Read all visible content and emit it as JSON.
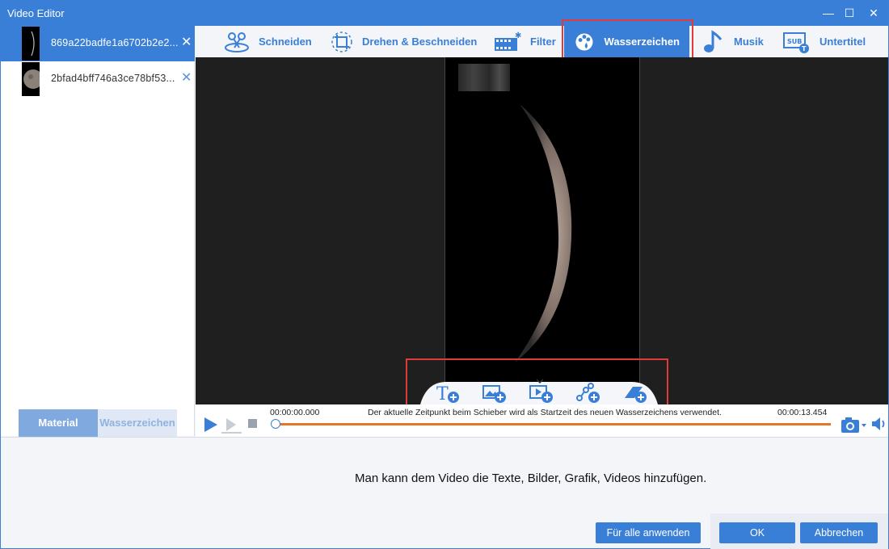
{
  "window": {
    "title": "Video Editor",
    "minimize": "—",
    "maximize": "☐",
    "close": "✕"
  },
  "files": [
    {
      "name": "869a22badfe1a6702b2e2...",
      "remove": "✕",
      "selected": true
    },
    {
      "name": "2bfad4bff746a3ce78bf53...",
      "remove": "✕",
      "selected": false
    }
  ],
  "left_tabs": {
    "material": "Material",
    "watermark": "Wasserzeichen"
  },
  "toolbar": {
    "cut": "Schneiden",
    "rotate_crop": "Drehen & Beschneiden",
    "filter": "Filter",
    "watermark": "Wasserzeichen",
    "music": "Musik",
    "subtitle": "Untertitel"
  },
  "timeline": {
    "start_time": "00:00:00.000",
    "end_time": "00:00:13.454",
    "hint": "Der aktuelle Zeitpunkt beim Schieber wird als Startzeit des neuen Wasserzeichens verwendet.",
    "progress": 0
  },
  "footer": {
    "message": "Man kann dem Video die Texte, Bilder, Grafik, Videos hinzufügen.",
    "apply_all": "Für alle anwenden",
    "ok": "OK",
    "cancel": "Abbrechen"
  },
  "colors": {
    "accent": "#3a7fd7",
    "highlight_box": "#e03a3a",
    "track": "#e8732a"
  }
}
